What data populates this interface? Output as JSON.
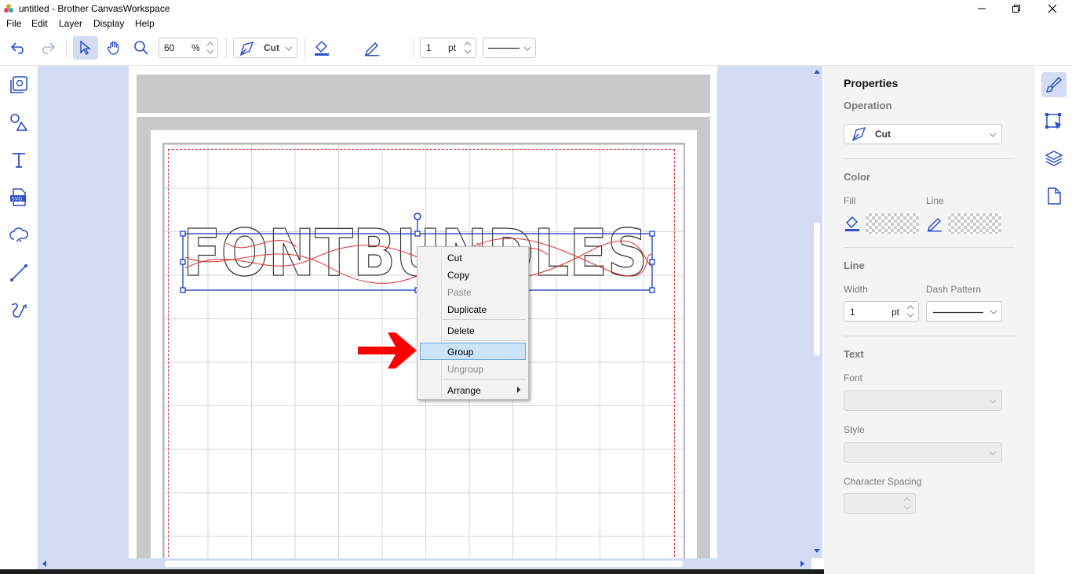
{
  "window": {
    "title": "untitled - Brother CanvasWorkspace"
  },
  "menubar": {
    "items": [
      "File",
      "Edit",
      "Layer",
      "Display",
      "Help"
    ]
  },
  "toolbar": {
    "zoom_value": "60",
    "zoom_unit": "%",
    "operation": "Cut",
    "line_width": "1",
    "line_unit": "pt"
  },
  "canvas": {
    "text_object": "FONTBUNDLES"
  },
  "context_menu": {
    "items": [
      "Cut",
      "Copy",
      "Paste",
      "Duplicate",
      "Delete",
      "Group",
      "Ungroup",
      "Arrange"
    ],
    "disabled": [
      "Paste",
      "Ungroup"
    ],
    "highlighted": "Group"
  },
  "properties": {
    "title": "Properties",
    "operation_label": "Operation",
    "operation_value": "Cut",
    "color_label": "Color",
    "fill_label": "Fill",
    "line_label": "Line",
    "line_section": "Line",
    "width_label": "Width",
    "width_value": "1",
    "width_unit": "pt",
    "dash_label": "Dash Pattern",
    "text_section": "Text",
    "font_label": "Font",
    "style_label": "Style",
    "spacing_label": "Character Spacing"
  },
  "colors": {
    "accent": "#2d4fc7",
    "canvas_bg": "#d3dcf2",
    "cut_line": "#e03030",
    "arrow": "#ff0000"
  }
}
